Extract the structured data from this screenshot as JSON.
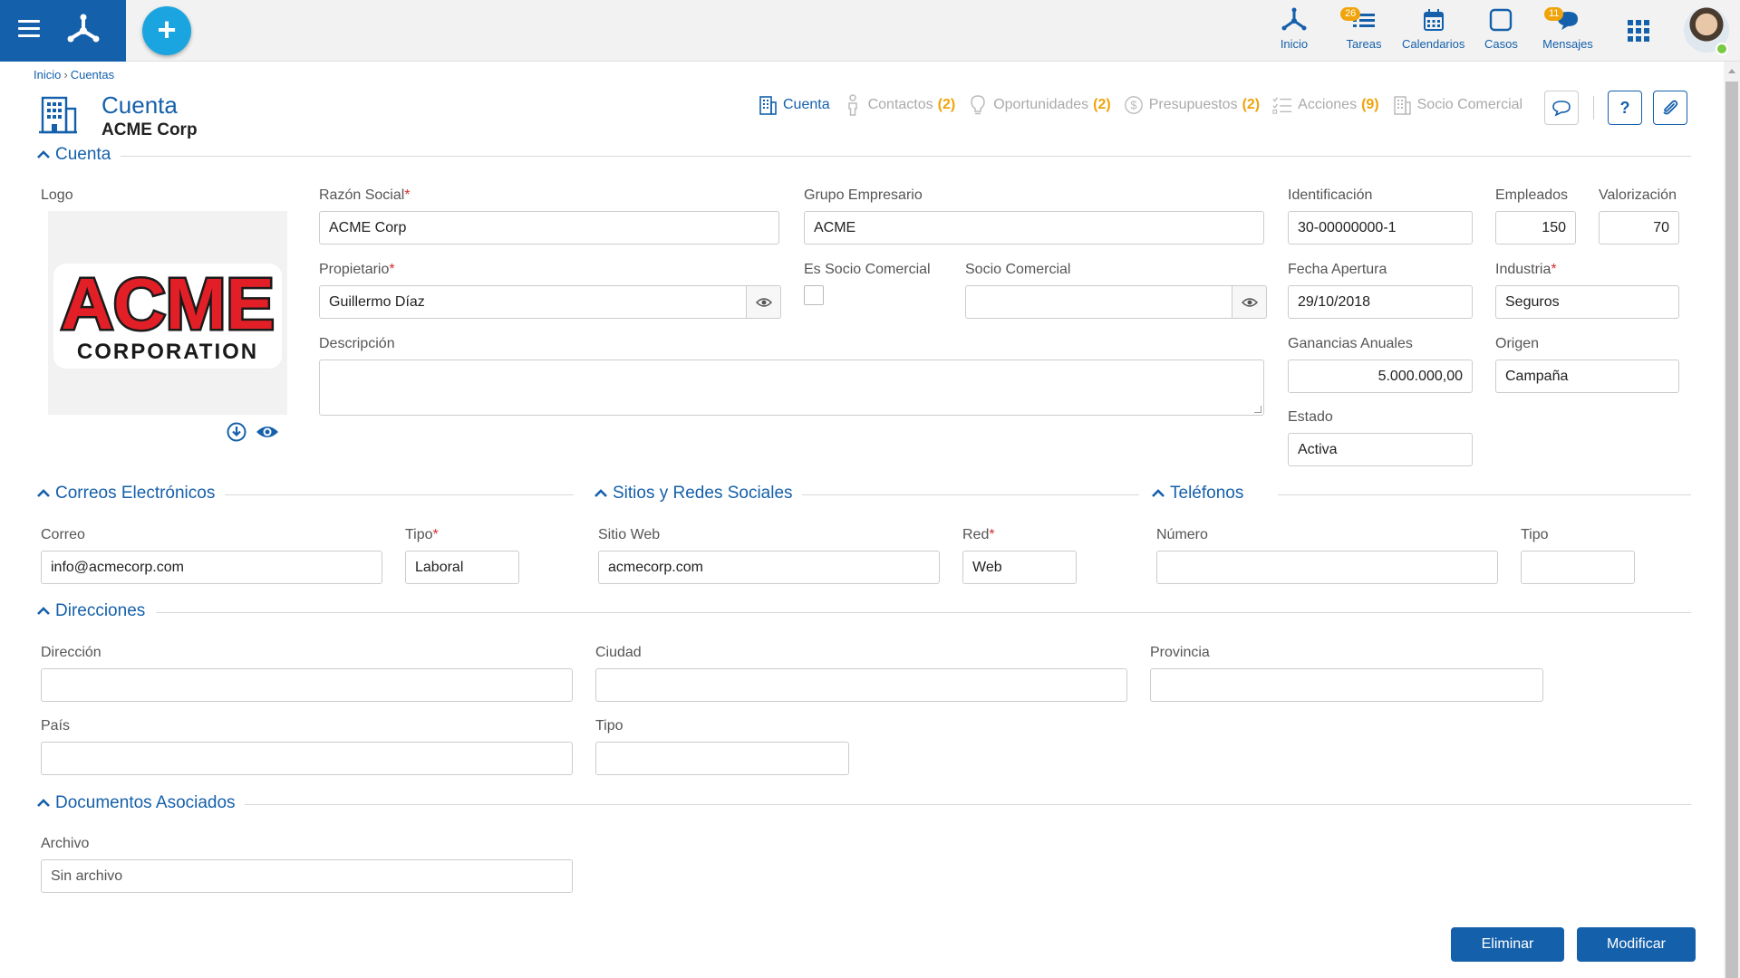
{
  "topbar": {
    "nav": [
      {
        "label": "Inicio",
        "badge": ""
      },
      {
        "label": "Tareas",
        "badge": "26"
      },
      {
        "label": "Calendarios",
        "badge": ""
      },
      {
        "label": "Casos",
        "badge": ""
      },
      {
        "label": "Mensajes",
        "badge": "11"
      }
    ]
  },
  "breadcrumb": {
    "home": "Inicio",
    "separator": "›",
    "current": "Cuentas"
  },
  "header": {
    "title": "Cuenta",
    "subtitle": "ACME Corp"
  },
  "tabs": [
    {
      "label": "Cuenta",
      "count": ""
    },
    {
      "label": "Contactos",
      "count": "(2)"
    },
    {
      "label": "Oportunidades",
      "count": "(2)"
    },
    {
      "label": "Presupuestos",
      "count": "(2)"
    },
    {
      "label": "Acciones",
      "count": "(9)"
    },
    {
      "label": "Socio Comercial",
      "count": ""
    }
  ],
  "help_label": "?",
  "sections": {
    "cuenta": "Cuenta",
    "correos": "Correos Electrónicos",
    "sitios": "Sitios y Redes Sociales",
    "telefonos": "Teléfonos",
    "direcciones": "Direcciones",
    "documentos": "Documentos Asociados"
  },
  "cuenta": {
    "logo_label": "Logo",
    "logo_text_main": "ACME",
    "logo_text_sub": "CORPORATION",
    "razon_social_label": "Razón Social",
    "razon_social": "ACME Corp",
    "grupo_label": "Grupo Empresario",
    "grupo": "ACME",
    "identificacion_label": "Identificación",
    "identificacion": "30-00000000-1",
    "empleados_label": "Empleados",
    "empleados": "150",
    "valorizacion_label": "Valorización",
    "valorizacion": "70",
    "propietario_label": "Propietario",
    "propietario": "Guillermo Díaz",
    "es_socio_label": "Es Socio Comercial",
    "socio_label": "Socio Comercial",
    "socio": "",
    "fecha_label": "Fecha Apertura",
    "fecha": "29/10/2018",
    "industria_label": "Industria",
    "industria": "Seguros",
    "descripcion_label": "Descripción",
    "ganancias_label": "Ganancias Anuales",
    "ganancias": "5.000.000,00",
    "origen_label": "Origen",
    "origen": "Campaña",
    "estado_label": "Estado",
    "estado": "Activa",
    "required_mark": "*"
  },
  "correos": {
    "correo_label": "Correo",
    "correo": "info@acmecorp.com",
    "tipo_label": "Tipo",
    "tipo": "Laboral"
  },
  "sitios": {
    "sitio_label": "Sitio Web",
    "sitio": "acmecorp.com",
    "red_label": "Red",
    "red": "Web"
  },
  "telefonos": {
    "numero_label": "Número",
    "tipo_label": "Tipo"
  },
  "direcciones": {
    "direccion_label": "Dirección",
    "ciudad_label": "Ciudad",
    "provincia_label": "Provincia",
    "pais_label": "País",
    "tipo_label": "Tipo"
  },
  "documentos": {
    "archivo_label": "Archivo",
    "archivo": "Sin archivo"
  },
  "actions": {
    "eliminar": "Eliminar",
    "modificar": "Modificar"
  },
  "colors": {
    "primary": "#1560ab",
    "accent": "#1ba5e0",
    "badge": "#f0a30a",
    "required": "#d32f2f"
  }
}
